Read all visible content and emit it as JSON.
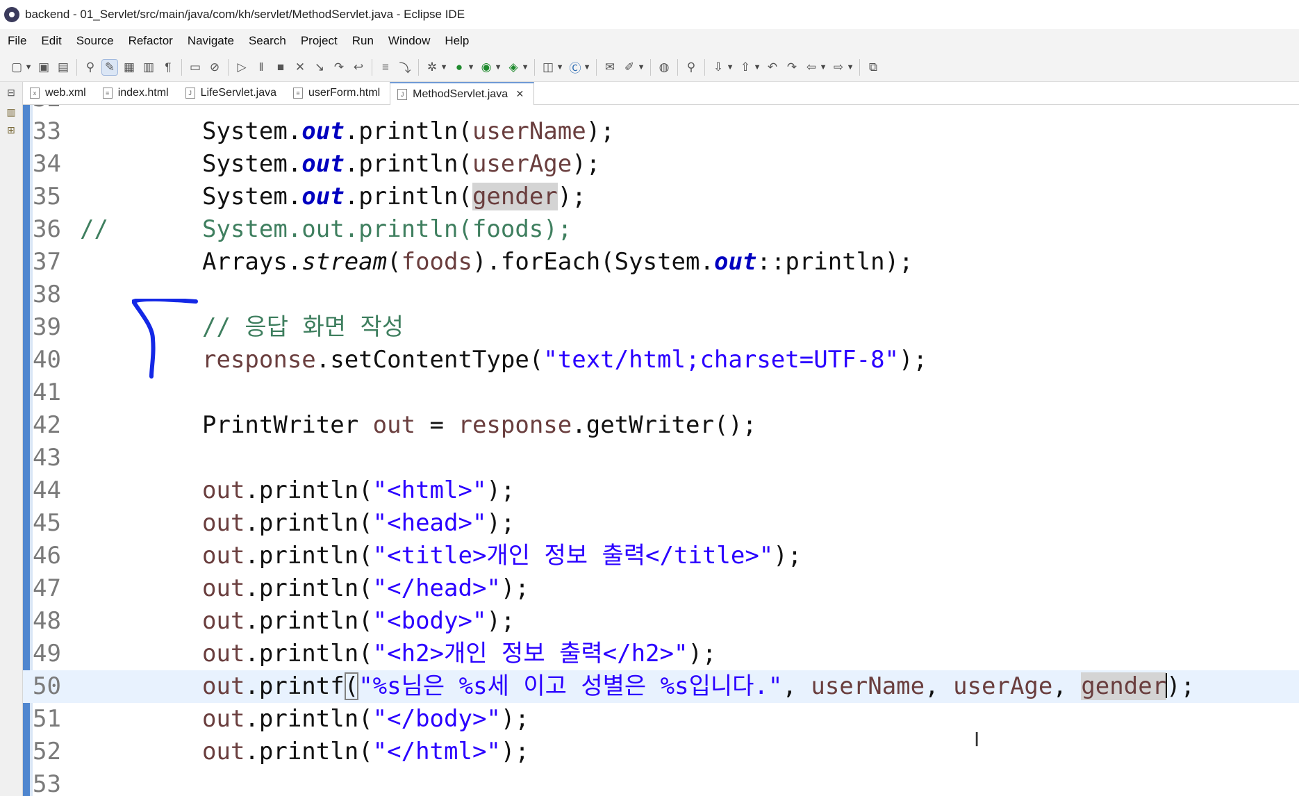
{
  "window": {
    "title": "backend - 01_Servlet/src/main/java/com/kh/servlet/MethodServlet.java - Eclipse IDE"
  },
  "menu": [
    "File",
    "Edit",
    "Source",
    "Refactor",
    "Navigate",
    "Search",
    "Project",
    "Run",
    "Window",
    "Help"
  ],
  "tabs": [
    {
      "label": "web.xml",
      "icon": "xml-file-icon",
      "active": false
    },
    {
      "label": "index.html",
      "icon": "html-file-icon",
      "active": false
    },
    {
      "label": "LifeServlet.java",
      "icon": "java-file-icon",
      "active": false
    },
    {
      "label": "userForm.html",
      "icon": "html-file-icon",
      "active": false
    },
    {
      "label": "MethodServlet.java",
      "icon": "java-file-icon",
      "active": true,
      "close": "×"
    }
  ],
  "editor": {
    "current_line": "50",
    "lines": [
      {
        "num": "32",
        "text": ""
      },
      {
        "num": "33",
        "text": "System.out.println(userName);"
      },
      {
        "num": "34",
        "text": "System.out.println(userAge);"
      },
      {
        "num": "35",
        "text": "System.out.println(gender);"
      },
      {
        "num": "36",
        "text": "//        System.out.println(foods);"
      },
      {
        "num": "37",
        "text": "Arrays.stream(foods).forEach(System.out::println);"
      },
      {
        "num": "38",
        "text": ""
      },
      {
        "num": "39",
        "text": "// 응답 화면 작성"
      },
      {
        "num": "40",
        "text": "response.setContentType(\"text/html;charset=UTF-8\");"
      },
      {
        "num": "41",
        "text": ""
      },
      {
        "num": "42",
        "text": "PrintWriter out = response.getWriter();"
      },
      {
        "num": "43",
        "text": ""
      },
      {
        "num": "44",
        "text": "out.println(\"<html>\");"
      },
      {
        "num": "45",
        "text": "out.println(\"<head>\");"
      },
      {
        "num": "46",
        "text": "out.println(\"<title>개인 정보 출력</title>\");"
      },
      {
        "num": "47",
        "text": "out.println(\"</head>\");"
      },
      {
        "num": "48",
        "text": "out.println(\"<body>\");"
      },
      {
        "num": "49",
        "text": "out.println(\"<h2>개인 정보 출력</h2>\");"
      },
      {
        "num": "50",
        "text": "out.printf(\"%s님은 %s세 이고 성별은 %s입니다.\", userName, userAge, gender);"
      },
      {
        "num": "51",
        "text": "out.println(\"</body>\");"
      },
      {
        "num": "52",
        "text": "out.println(\"</html>\");"
      },
      {
        "num": "53",
        "text": ""
      }
    ]
  },
  "colors": {
    "keyword": "#7f0055",
    "static_field": "#0000c0",
    "string": "#2a00ff",
    "comment": "#3f7f5f",
    "local_var": "#6a3e3e",
    "current_line_bg": "#e8f2fe",
    "annotation_pen": "#1428e6"
  }
}
